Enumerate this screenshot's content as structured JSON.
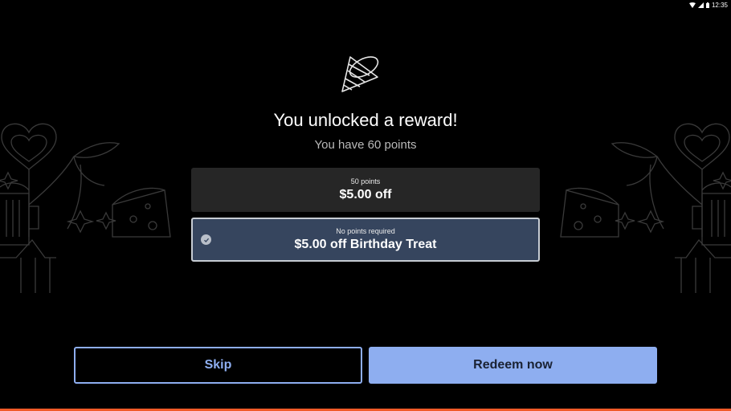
{
  "status": {
    "time": "12:35"
  },
  "header": {
    "title": "You unlocked a reward!",
    "subtitle": "You have 60 points"
  },
  "rewards": [
    {
      "points_label": "50 points",
      "reward_label": "$5.00 off",
      "selected": false
    },
    {
      "points_label": "No points required",
      "reward_label": "$5.00 off Birthday Treat",
      "selected": true
    }
  ],
  "actions": {
    "skip_label": "Skip",
    "redeem_label": "Redeem now"
  },
  "colors": {
    "background": "#000000",
    "accent": "#8eaef0",
    "selected_card": "#36455e",
    "unselected_card": "#262626",
    "brand_strip": "#f05a28"
  },
  "icons": [
    "wifi-icon",
    "signal-icon",
    "battery-icon",
    "party-hat-icon",
    "check-circle-icon"
  ]
}
